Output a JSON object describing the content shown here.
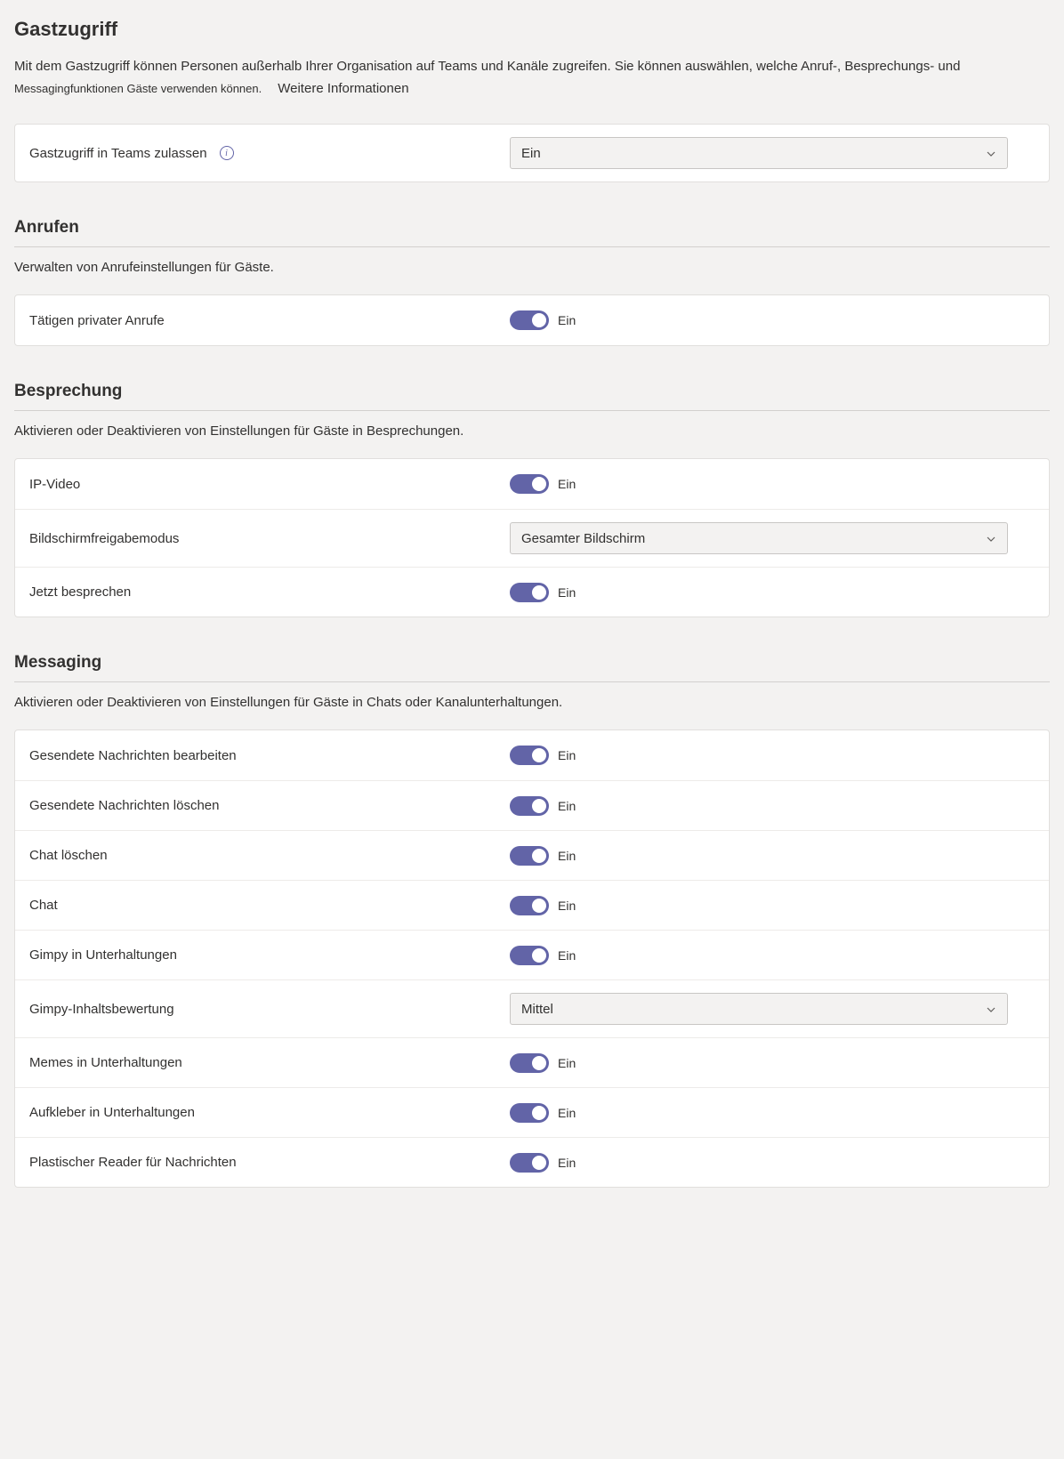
{
  "header": {
    "title": "Gastzugriff",
    "description_line1": "Mit dem Gastzugriff können Personen außerhalb Ihrer Organisation auf Teams und Kanäle zugreifen. Sie können auswählen, welche Anruf-, Besprechungs- und",
    "description_line2": "Messagingfunktionen Gäste verwenden können.",
    "more_info": "Weitere Informationen"
  },
  "top_card": {
    "label": "Gastzugriff in Teams zulassen",
    "value": "Ein"
  },
  "toggle_states": {
    "on": "Ein"
  },
  "calling": {
    "title": "Anrufen",
    "desc": "Verwalten von Anrufeinstellungen für Gäste.",
    "rows": [
      {
        "label": "Tätigen privater Anrufe",
        "type": "toggle",
        "value": "Ein"
      }
    ]
  },
  "meeting": {
    "title": "Besprechung",
    "desc": "Aktivieren oder Deaktivieren von Einstellungen für Gäste in Besprechungen.",
    "rows": [
      {
        "label": "IP-Video",
        "type": "toggle",
        "value": "Ein"
      },
      {
        "label": "Bildschirmfreigabemodus",
        "type": "select",
        "value": "Gesamter Bildschirm"
      },
      {
        "label": "Jetzt besprechen",
        "type": "toggle",
        "value": "Ein"
      }
    ]
  },
  "messaging": {
    "title": "Messaging",
    "desc": "Aktivieren oder Deaktivieren von Einstellungen für Gäste in Chats oder Kanalunterhaltungen.",
    "rows": [
      {
        "label": "Gesendete Nachrichten bearbeiten",
        "type": "toggle",
        "value": "Ein"
      },
      {
        "label": "Gesendete Nachrichten löschen",
        "type": "toggle",
        "value": "Ein"
      },
      {
        "label": "Chat löschen",
        "type": "toggle",
        "value": "Ein"
      },
      {
        "label": "Chat",
        "type": "toggle",
        "value": "Ein"
      },
      {
        "label": "Gimpy in Unterhaltungen",
        "type": "toggle",
        "value": "Ein"
      },
      {
        "label": "Gimpy-Inhaltsbewertung",
        "type": "select",
        "value": "Mittel"
      },
      {
        "label": "Memes in Unterhaltungen",
        "type": "toggle",
        "value": "Ein"
      },
      {
        "label": "Aufkleber in Unterhaltungen",
        "type": "toggle",
        "value": "Ein"
      },
      {
        "label": "Plastischer Reader für Nachrichten",
        "type": "toggle",
        "value": "Ein"
      }
    ]
  }
}
